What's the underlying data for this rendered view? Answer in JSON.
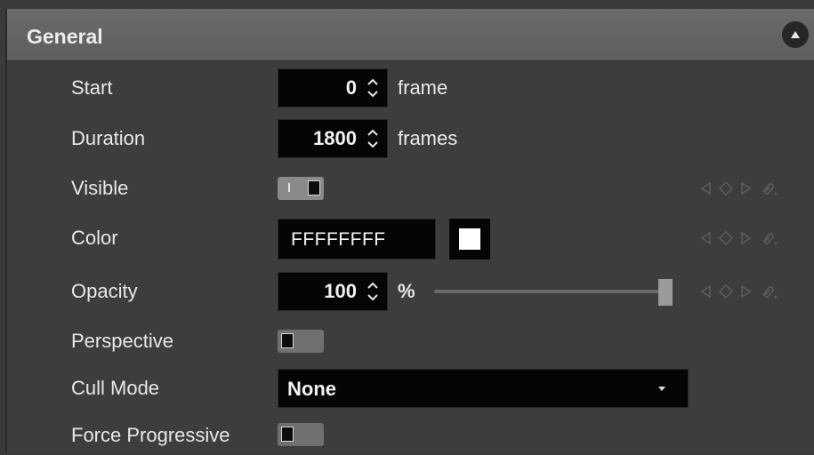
{
  "panel": {
    "title": "General",
    "collapse_icon": "chevron-up-icon"
  },
  "rows": {
    "start": {
      "label": "Start",
      "value": "0",
      "unit": "frame"
    },
    "duration": {
      "label": "Duration",
      "value": "1800",
      "unit": "frames"
    },
    "visible": {
      "label": "Visible",
      "state": "on"
    },
    "color": {
      "label": "Color",
      "value": "FFFFFFFF",
      "swatch": "#FFFFFF"
    },
    "opacity": {
      "label": "Opacity",
      "value": "100",
      "unit": "%",
      "slider_fraction": 1.0
    },
    "perspective": {
      "label": "Perspective",
      "state": "off"
    },
    "cull_mode": {
      "label": "Cull Mode",
      "value": "None"
    },
    "force_progressive": {
      "label": "Force Progressive",
      "state": "off"
    }
  },
  "keyframe_controls": {
    "icons": [
      "prev-keyframe-icon",
      "keyframe-icon",
      "next-keyframe-icon",
      "link-icon"
    ]
  },
  "colors": {
    "header_bg": "#636363",
    "panel_bg": "#3d3d3d",
    "field_bg": "#050505",
    "text": "#e8e8e8"
  }
}
